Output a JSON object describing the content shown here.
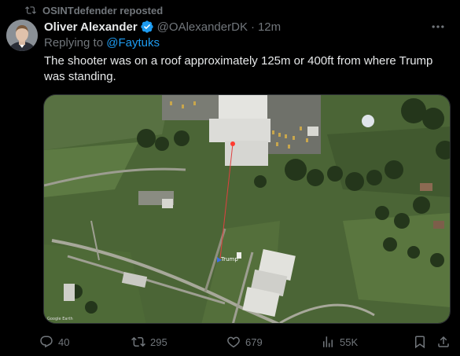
{
  "repost": {
    "label": "OSINTdefender reposted"
  },
  "author": {
    "name": "Oliver Alexander",
    "handle": "@OAlexanderDK",
    "separator": "·",
    "time": "12m"
  },
  "reply": {
    "prefix": "Replying to ",
    "mention": "@Faytuks"
  },
  "tweet": {
    "text": "The shooter was on a roof approximately 125m or 400ft from where Trump was standing."
  },
  "media": {
    "label": "Trump",
    "watermark": "Google Earth"
  },
  "actions": {
    "replies": "40",
    "reposts": "295",
    "likes": "679",
    "views": "55K"
  },
  "colors": {
    "background": "#000000",
    "text": "#e7e9ea",
    "muted": "#71767b",
    "link": "#1d9bf0",
    "verified": "#1d9bf0"
  },
  "icons": [
    "repost-icon",
    "verified-badge-icon",
    "more-icon",
    "reply-icon",
    "like-icon",
    "views-icon",
    "bookmark-icon",
    "share-icon"
  ]
}
